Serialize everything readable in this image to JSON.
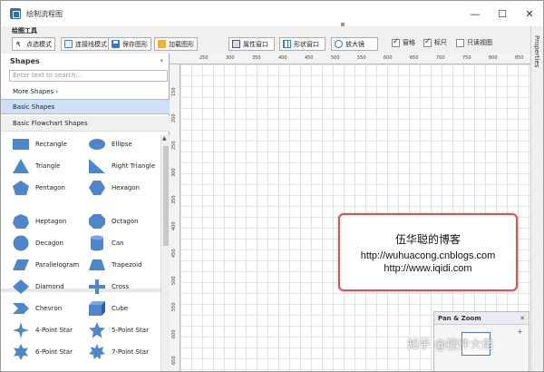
{
  "window": {
    "title": "绘制流程图",
    "minimize": "—",
    "maximize": "☐",
    "close": "✕"
  },
  "properties_tab": "Properties",
  "toolbar": {
    "heading": "绘图工具",
    "buttons": [
      {
        "label": "点选模式",
        "icon": "pointer-icon"
      },
      {
        "label": "连接线模式",
        "icon": "connector-icon"
      },
      {
        "label": "保存图形",
        "icon": "save-icon"
      },
      {
        "label": "加载图形",
        "icon": "folder-icon"
      },
      {
        "label": "属性窗口",
        "icon": "properties-window-icon"
      },
      {
        "label": "形状窗口",
        "icon": "shapes-window-icon"
      },
      {
        "label": "放大镜",
        "icon": "magnifier-icon"
      }
    ],
    "checkboxes": [
      {
        "label": "窗格",
        "checked": true
      },
      {
        "label": "标尺",
        "checked": true
      },
      {
        "label": "只读视图",
        "checked": false
      }
    ]
  },
  "sidebar": {
    "title": "Shapes",
    "collapse": "‹",
    "search_placeholder": "Enter text to search...",
    "more": "More Shapes  ›",
    "categories": [
      {
        "label": "Basic Shapes",
        "active": true
      },
      {
        "label": "Basic Flowchart Shapes",
        "active": false
      }
    ],
    "shapes": [
      {
        "label": "Rectangle",
        "icon": "rectangle-icon"
      },
      {
        "label": "Ellipse",
        "icon": "ellipse-icon"
      },
      {
        "label": "Triangle",
        "icon": "triangle-icon"
      },
      {
        "label": "Right Triangle",
        "icon": "right-triangle-icon"
      },
      {
        "label": "Pentagon",
        "icon": "pentagon-icon"
      },
      {
        "label": "Hexagon",
        "icon": "hexagon-icon"
      },
      {
        "label": "Heptagon",
        "icon": "heptagon-icon"
      },
      {
        "label": "Octagon",
        "icon": "octagon-icon"
      },
      {
        "label": "Decagon",
        "icon": "decagon-icon"
      },
      {
        "label": "Can",
        "icon": "can-icon"
      },
      {
        "label": "Parallelogram",
        "icon": "parallelogram-icon"
      },
      {
        "label": "Trapezoid",
        "icon": "trapezoid-icon"
      },
      {
        "label": "Diamond",
        "icon": "diamond-icon"
      },
      {
        "label": "Cross",
        "icon": "cross-icon"
      },
      {
        "label": "Chevron",
        "icon": "chevron-icon"
      },
      {
        "label": "Cube",
        "icon": "cube-icon"
      },
      {
        "label": "4-Point Star",
        "icon": "four-point-star-icon"
      },
      {
        "label": "5-Point Star",
        "icon": "five-point-star-icon"
      },
      {
        "label": "6-Point Star",
        "icon": "six-point-star-icon"
      },
      {
        "label": "7-Point Star",
        "icon": "seven-point-star-icon"
      }
    ]
  },
  "ruler": {
    "top": [
      "250",
      "300",
      "350",
      "400",
      "450",
      "500",
      "550",
      "600",
      "650",
      "700",
      "750",
      "800",
      "850"
    ],
    "left": [
      "150",
      "200",
      "250",
      "300",
      "350",
      "400",
      "450",
      "500",
      "550",
      "600",
      "650"
    ]
  },
  "blog_box": {
    "name": "伍华聪的博客",
    "url1": "http://wuhuacong.cnblogs.com",
    "url2": "http://www.iqidi.com"
  },
  "pan_zoom": {
    "title": "Pan & Zoom",
    "close": "✕",
    "plus": "+"
  },
  "watermark": "知乎 @控件大佬",
  "colors": {
    "shape_fill": "#4f86c9",
    "accent": "#2d6fb8",
    "callout_border": "#d9534f"
  }
}
